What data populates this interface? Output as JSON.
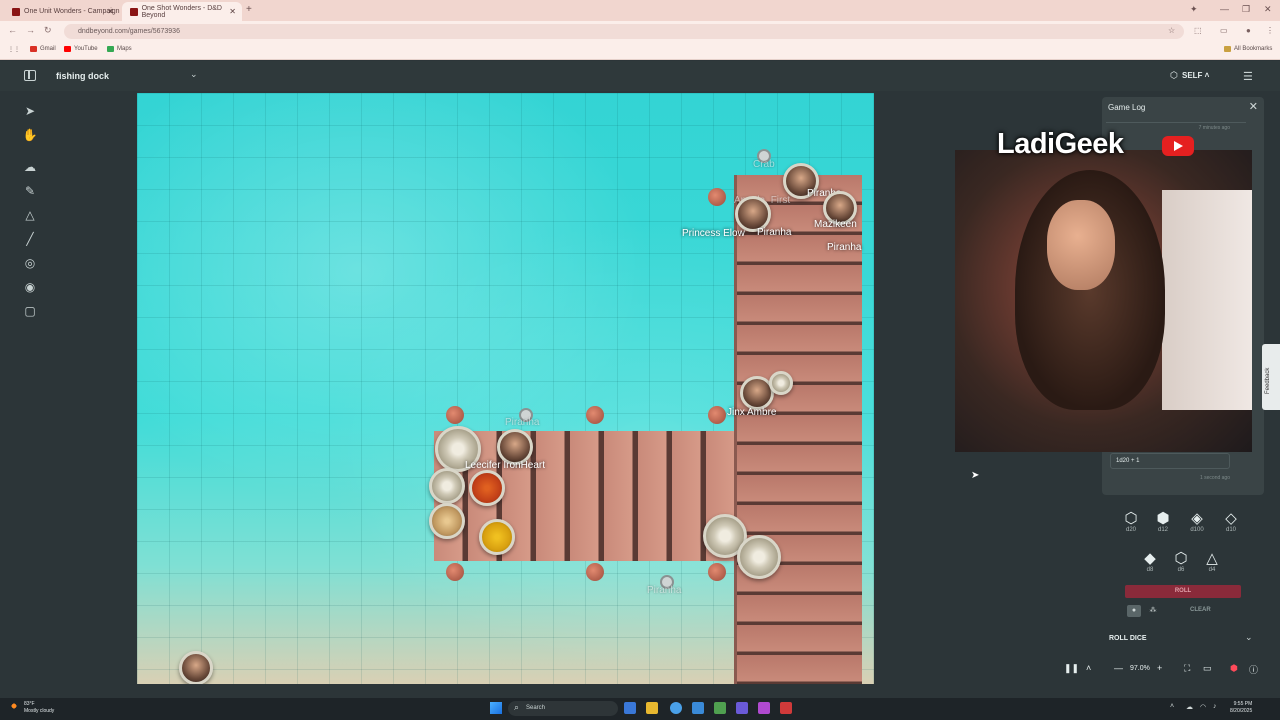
{
  "browser": {
    "tabs": [
      {
        "label": "One Unit Wonders - Campaign"
      },
      {
        "label": "One Shot Wonders - D&D Beyond"
      }
    ],
    "url": "dndbeyond.com/games/5673936",
    "bookmarks": [
      "Gmail",
      "YouTube",
      "Maps"
    ],
    "all_bookmarks": "All Bookmarks"
  },
  "app": {
    "map_name": "fishing dock",
    "view_mode": "SELF"
  },
  "tools": [
    "select-icon",
    "hand-icon",
    "fog-icon",
    "draw-icon",
    "shapes-icon",
    "ruler-icon",
    "target-icon",
    "token-icon",
    "note-icon"
  ],
  "map": {
    "labels": {
      "crab": "Crab",
      "piranha_top": "Piranha",
      "angela": "Angela, First",
      "princess": "Princess Elow",
      "piranha_mid": "Piranha",
      "mazikeen": "Mazikeen",
      "piranha_right": "Piranha",
      "jinx": "Jinx Ambre",
      "piranha_dock": "Piranha",
      "leecifer": "Leecifer IronHeart",
      "piranha_bottom": "Piranha"
    }
  },
  "game_log": {
    "title": "Game Log",
    "timestamp_top": "7 minutes ago",
    "last_roll": "1d20 + 1",
    "timestamp_bottom": "1 second ago"
  },
  "stream": {
    "brand": "LadiGeek"
  },
  "feedback": "Feedback",
  "dice": {
    "row1": [
      {
        "glyph": "⬡",
        "label": "d20"
      },
      {
        "glyph": "⬢",
        "label": "d12"
      },
      {
        "glyph": "◈",
        "label": "d100"
      },
      {
        "glyph": "◇",
        "label": "d10"
      }
    ],
    "row2": [
      {
        "glyph": "◆",
        "label": "d8"
      },
      {
        "glyph": "⬡",
        "label": "d6"
      },
      {
        "glyph": "△",
        "label": "d4"
      }
    ],
    "roll": "ROLL",
    "clear": "CLEAR",
    "section": "ROLL DICE"
  },
  "controls": {
    "zoom": "97.0%"
  },
  "taskbar": {
    "weather_temp": "83°F",
    "weather_desc": "Mostly cloudy",
    "search": "Search",
    "time": "9:55 PM",
    "date": "8/20/2025"
  },
  "colors": {
    "accent": "#8a2a3a",
    "panel": "#3a4446",
    "water": "#33d4d4"
  }
}
